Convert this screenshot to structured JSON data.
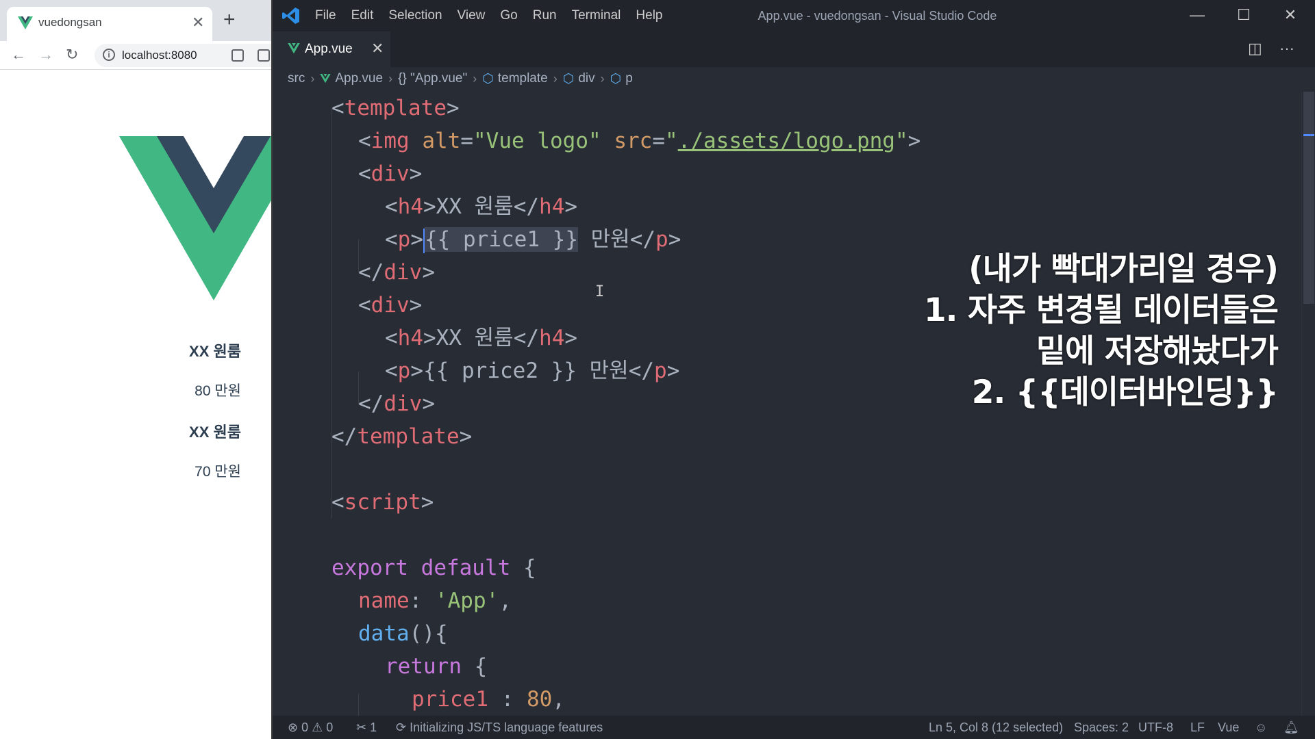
{
  "browser": {
    "tab_title": "vuedongsan",
    "tab_close": "✕",
    "new_tab": "+",
    "url": "localhost:8080",
    "nav": {
      "back": "←",
      "forward": "→",
      "reload": "↻"
    },
    "page": {
      "items": [
        {
          "title": "XX 원룸",
          "price": "80 만원"
        },
        {
          "title": "XX 원룸",
          "price": "70 만원"
        }
      ]
    }
  },
  "vscode": {
    "menu": [
      "File",
      "Edit",
      "Selection",
      "View",
      "Go",
      "Run",
      "Terminal",
      "Help"
    ],
    "window_title": "App.vue - vuedongsan - Visual Studio Code",
    "window_controls": {
      "minimize": "—",
      "maximize": "☐",
      "close": "✕"
    },
    "tab": {
      "label": "App.vue",
      "close": "✕"
    },
    "tab_actions": {
      "split": "◫",
      "more": "···"
    },
    "breadcrumb": [
      "src",
      "App.vue",
      "{} \"App.vue\"",
      "template",
      "div",
      "p"
    ],
    "code": {
      "l1_tag": "template",
      "l2_tag": "img",
      "l2_attr1": "alt",
      "l2_val1": "\"Vue logo\"",
      "l2_attr2": "src",
      "l2_val2_q": "\"",
      "l2_val2": "./assets/logo.png",
      "l3_tag": "div",
      "l4_tag": "h4",
      "l4_text": "XX 원룸",
      "l5_tag": "p",
      "l5_sel": "{{ price1 }}",
      "l5_text": " 만원",
      "l6_tag": "div",
      "l7_tag": "div",
      "l8_tag": "h4",
      "l8_text": "XX 원룸",
      "l9_tag": "p",
      "l9_text": "{{ price2 }} 만원",
      "l10_tag": "div",
      "l11_tag": "template",
      "l13_tag": "script",
      "l15_kw1": "export",
      "l15_kw2": "default",
      "l15_brace": " {",
      "l16_key": "name",
      "l16_val": "'App'",
      "l17_fn": "data",
      "l17_rest": "(){",
      "l18_kw": "return",
      "l18_brace": " {",
      "l19_key": "price1",
      "l19_sep": " : ",
      "l19_val": "80",
      "l19_comma": ","
    },
    "overlay": {
      "line1": "(내가 빡대가리일 경우)",
      "line2": "1. 자주 변경될 데이터들은",
      "line3": "밑에 저장해놨다가",
      "line4": "2. {{데이터바인딩}}"
    },
    "status": {
      "errors": "0",
      "warnings": "0",
      "ports": "1",
      "task": "Initializing JS/TS language features",
      "position": "Ln 5, Col 8 (12 selected)",
      "spaces": "Spaces: 2",
      "encoding": "UTF-8",
      "eol": "LF",
      "language": "Vue"
    },
    "colors": {
      "bg": "#282c34",
      "chrome": "#21252b",
      "tag": "#e06c75",
      "string": "#98c379",
      "keyword": "#c678dd",
      "function": "#61afef",
      "number": "#d19a66"
    }
  }
}
